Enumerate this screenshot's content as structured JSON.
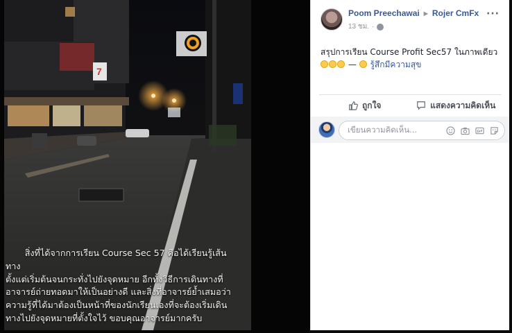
{
  "post": {
    "author": "Poom Preechawai",
    "target": "Rojer CmFx",
    "time": "13 ชม.",
    "dot": "·",
    "more": "···",
    "text": "สรุปการเรียน Course Profit Sec57 ในภาพเดียว",
    "dash": "—",
    "feeling": "รู้สึกมีความสุข"
  },
  "actions": {
    "like": "ถูกใจ",
    "comment": "แสดงความคิดเห็น"
  },
  "comment_input": {
    "placeholder": "เขียนความคิดเห็น..."
  },
  "photo": {
    "caption": "สิ่งที่ได้จากการเรียน Course Sec 57  คือได้เรียนรู้เส้นทาง\nตั้งแต่เริ่มต้นจนกระทั่งไปยังจุดหมาย อีกทั้งวิธีการเดินทางที่\nอาจารย์ถ่ายทอดมาให้เป็นอย่างดี  และสิ่งที่อาจารย์ย้ำเสมอว่า\nความรู้ที่ได้มาต้องเป็นหน้าที่ของนักเรียนเองที่จะต้องเริ่มเดิน\nทางไปยังจุดหมายที่ตั้งใจไว้      ขอบคุณอาจารย์มากครับ",
    "store_sign": "7"
  },
  "colors": {
    "link": "#385898",
    "text": "#1d2129",
    "muted": "#90949c",
    "emoji": "#ffcb4c"
  }
}
